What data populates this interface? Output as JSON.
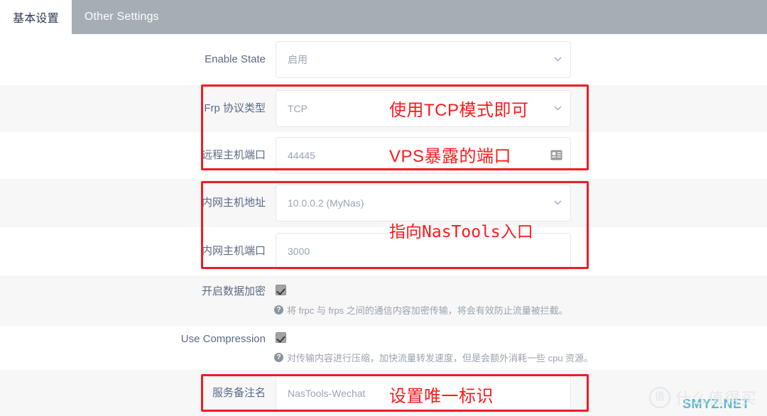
{
  "tabs": [
    {
      "label": "基本设置",
      "active": true
    },
    {
      "label": "Other Settings",
      "active": false
    }
  ],
  "colors": {
    "tabbar_bg": "#a6adb4",
    "active_tab_bg": "#ffffff",
    "annotation_red": "#fb1b1b",
    "row_stripe": "#f7f7f7",
    "watermark_teal": "#5bb9c9"
  },
  "form": {
    "rows": [
      {
        "label": "Enable State",
        "value": "启用",
        "control": "select",
        "icon": "chevron-down-icon",
        "stripe": "white"
      },
      {
        "label": "Frp 协议类型",
        "value": "TCP",
        "control": "select",
        "icon": "chevron-down-icon",
        "stripe": "gray"
      },
      {
        "label": "远程主机端口",
        "value": "44445",
        "control": "text",
        "icon": "contact-card-icon",
        "stripe": "white"
      },
      {
        "label": "内网主机地址",
        "value": "10.0.0.2 (MyNas)",
        "control": "select",
        "icon": "chevron-down-icon",
        "stripe": "gray"
      },
      {
        "label": "内网主机端口",
        "value": "3000",
        "control": "text",
        "icon": "none",
        "stripe": "white"
      }
    ],
    "checkboxes": [
      {
        "label": "开启数据加密",
        "checked": true,
        "hint": "将 frpc 与 frps 之间的通信内容加密传输，将会有效防止流量被拦截。",
        "stripe": "gray"
      },
      {
        "label": "Use Compression",
        "checked": true,
        "hint": "对传输内容进行压缩，加快流量转发速度，但是会额外消耗一些 cpu 资源。",
        "stripe": "white"
      }
    ],
    "last_row": {
      "label": "服务备注名",
      "value": "NasTools-Wechat",
      "stripe": "gray"
    }
  },
  "annotations": [
    {
      "text": "使用TCP模式即可",
      "style": "sans"
    },
    {
      "text": "VPS暴露的端口",
      "style": "sans"
    },
    {
      "text": "指向NasTools入口",
      "style": "mono"
    },
    {
      "text": "设置唯一标识",
      "style": "sans"
    }
  ],
  "watermark": {
    "badge": "值",
    "word": "什么值得买",
    "site": "SMYZ.NET"
  }
}
